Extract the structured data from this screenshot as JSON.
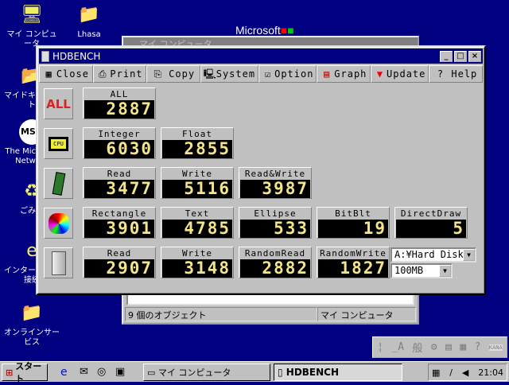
{
  "desktop": {
    "icons": [
      {
        "label": "マイ コンピュータ",
        "icon": "computer-icon"
      },
      {
        "label": "Lhasa",
        "icon": "folder-shortcut-icon"
      },
      {
        "label": "マイドキュメント",
        "icon": "documents-folder-icon"
      },
      {
        "label": "The Microsoft Network",
        "icon": "msn-icon"
      },
      {
        "label": "ごみ箱",
        "icon": "recycle-bin-icon"
      },
      {
        "label": "インターネット接続",
        "icon": "internet-connection-icon"
      },
      {
        "label": "オンラインサービス",
        "icon": "folder-icon"
      }
    ],
    "wallpaper_text": "Microsoft"
  },
  "background_window": {
    "title": "マイ コンピュータ",
    "status_count": "9 個のオブジェクト",
    "status_location": "マイ コンピュータ"
  },
  "hdbench": {
    "title": "HDBENCH",
    "toolbar": [
      {
        "label": "Close",
        "icon": "close-calendar-icon"
      },
      {
        "label": "Print",
        "icon": "printer-icon"
      },
      {
        "label": "Copy",
        "icon": "copy-icon"
      },
      {
        "label": "System",
        "icon": "computer-icon"
      },
      {
        "label": "Option",
        "icon": "checkbox-icon"
      },
      {
        "label": "Graph",
        "icon": "graph-icon"
      },
      {
        "label": "Update",
        "icon": "new-update-icon"
      },
      {
        "label": "Help",
        "icon": "help-icon"
      }
    ],
    "rows": [
      {
        "icon": "all-icon",
        "icon_text": "ALL",
        "panels": [
          {
            "label": "ALL",
            "value": "2887"
          }
        ]
      },
      {
        "icon": "cpu-icon",
        "icon_text": "CPU",
        "panels": [
          {
            "label": "Integer",
            "value": "6030"
          },
          {
            "label": "Float",
            "value": "2855"
          }
        ]
      },
      {
        "icon": "memory-icon",
        "panels": [
          {
            "label": "Read",
            "value": "3477"
          },
          {
            "label": "Write",
            "value": "5116"
          },
          {
            "label": "Read&Write",
            "value": "3987"
          }
        ]
      },
      {
        "icon": "video-icon",
        "panels": [
          {
            "label": "Rectangle",
            "value": "3901"
          },
          {
            "label": "Text",
            "value": "4785"
          },
          {
            "label": "Ellipse",
            "value": "533"
          },
          {
            "label": "BitBlt",
            "value": "19"
          },
          {
            "label": "DirectDraw",
            "value": "5"
          }
        ]
      },
      {
        "icon": "drive-icon",
        "panels": [
          {
            "label": "Read",
            "value": "2907"
          },
          {
            "label": "Write",
            "value": "3148"
          },
          {
            "label": "RandomRead",
            "value": "2882"
          },
          {
            "label": "RandomWrite",
            "value": "1827"
          }
        ]
      }
    ],
    "drive_select": "A:¥Hard Disk",
    "size_select": "100MB"
  },
  "taskbar": {
    "start": "スタート",
    "tasks": [
      "マイ コンピュータ",
      "HDBENCH"
    ],
    "clock": "21:04"
  },
  "ime": {
    "mode": "KANA"
  }
}
